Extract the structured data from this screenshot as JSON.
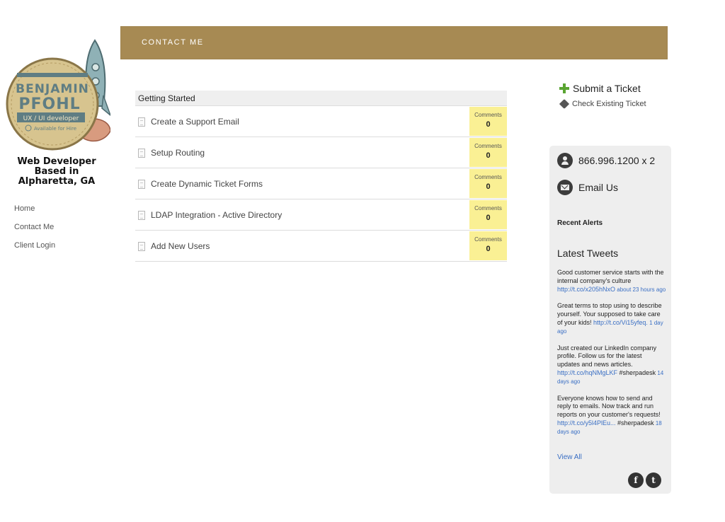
{
  "logo": {
    "line1": "BENJAMIN",
    "line2": "PFOHL",
    "role": "UX / UI developer",
    "availability": "Available for Hire"
  },
  "tagline": {
    "line1": "Web Developer",
    "line2": "Based in",
    "line3": "Alpharetta, GA"
  },
  "nav": {
    "items": [
      {
        "label": "Home"
      },
      {
        "label": "Contact Me"
      },
      {
        "label": "Client Login"
      }
    ]
  },
  "banner": {
    "title": "CONTACT ME"
  },
  "topics": {
    "header": "Getting Started",
    "comments_label": "Comments",
    "rows": [
      {
        "title": "Create a Support Email",
        "comments": "0"
      },
      {
        "title": "Setup Routing",
        "comments": "0"
      },
      {
        "title": "Create Dynamic Ticket Forms",
        "comments": "0"
      },
      {
        "title": "LDAP Integration - Active Directory",
        "comments": "0"
      },
      {
        "title": "Add New Users",
        "comments": "0"
      }
    ]
  },
  "tickets": {
    "submit_label": "Submit a Ticket",
    "check_label": "Check Existing Ticket"
  },
  "sidebar": {
    "phone": "866.996.1200 x 2",
    "email_label": "Email Us",
    "recent_alerts": "Recent Alerts",
    "latest_tweets": "Latest Tweets",
    "tweets": [
      {
        "text": "Good customer service starts with the internal company's culture ",
        "link": "http://t.co/x205hNxO",
        "extra": "",
        "time": " about 23 hours ago"
      },
      {
        "text": "Great terms to stop using to describe yourself. Your supposed to take care of your kids! ",
        "link": "http://t.co/Vi15yfeq.",
        "extra": "",
        "time": " 1 day ago"
      },
      {
        "text": "Just created our LinkedIn company profile. Follow us for the latest updates and news articles. ",
        "link": "http://t.co/hqNMgLKF",
        "extra": " #sherpadesk",
        "time": " 14 days ago"
      },
      {
        "text": "Everyone knows how to send and reply to emails. Now track and run reports on your customer's requests! ",
        "link": "http://t.co/y5l4PlEu...",
        "extra": " #sherpadesk",
        "time": " 18 days ago"
      }
    ],
    "view_all": "View All",
    "social": {
      "facebook": "f",
      "twitter": "t"
    }
  },
  "colors": {
    "banner": "#a78a53",
    "comments_bg": "#faf094",
    "link": "#3a6fc4",
    "plus": "#5aa532"
  }
}
